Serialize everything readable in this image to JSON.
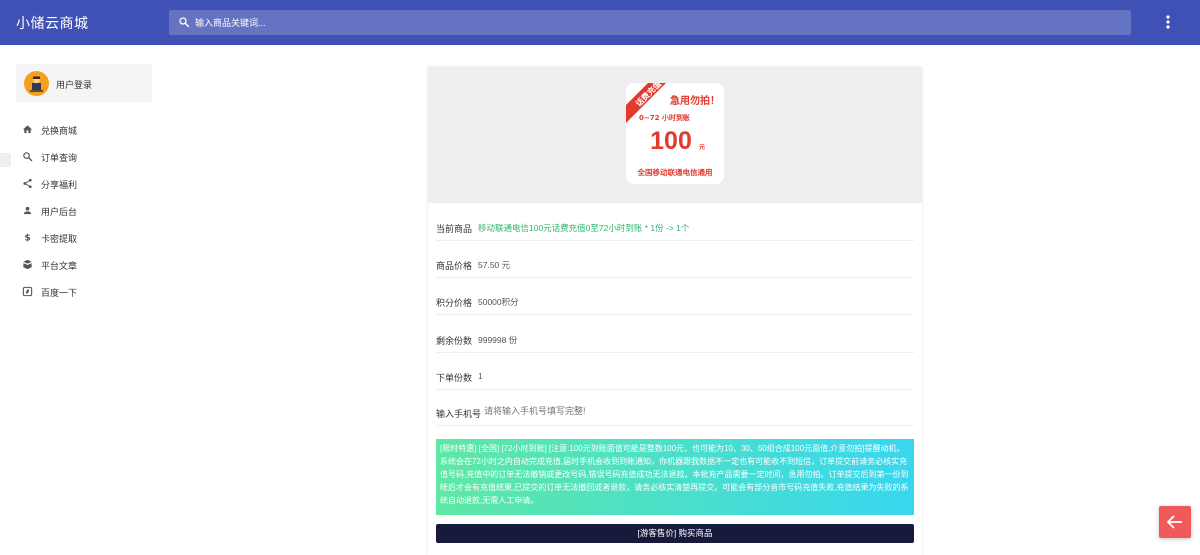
{
  "app": {
    "title": "小储云商城",
    "search_placeholder": "输入商品关键词..."
  },
  "colors": {
    "primary": "#3f51b5",
    "search_bg": "#6573c3",
    "accent_green": "#2fb36e",
    "notice_gradient_start": "#5ee8a4",
    "notice_gradient_end": "#38d6f0",
    "buy_button": "#181a3c",
    "fab": "#f15a5a"
  },
  "sidebar": {
    "user_label": "用户登录",
    "items": [
      {
        "label": "兑换商城",
        "icon": "home-icon"
      },
      {
        "label": "订单查询",
        "icon": "search-icon"
      },
      {
        "label": "分享福利",
        "icon": "share-icon"
      },
      {
        "label": "用户后台",
        "icon": "person-icon"
      },
      {
        "label": "卡密提取",
        "icon": "dollar-icon"
      },
      {
        "label": "平台文章",
        "icon": "book-icon"
      },
      {
        "label": "百度一下",
        "icon": "compass-icon"
      }
    ]
  },
  "product": {
    "image": {
      "ribbon": "话费充值",
      "headline": "急用勿拍！",
      "subline": "0~72 小时到账",
      "amount": "100",
      "unit": "元",
      "footer": "全国移动联通电信通用"
    },
    "fields": [
      {
        "label": "当前商品",
        "value": "移动联通电信100元话费充值0至72小时到账 * 1份 -> 1个"
      },
      {
        "label": "商品价格",
        "value": "57.50 元"
      },
      {
        "label": "积分价格",
        "value": "50000积分"
      },
      {
        "label": "剩余份数",
        "value": "999998 份"
      },
      {
        "label": "下单份数",
        "value": "1"
      }
    ],
    "phone": {
      "label": "输入手机号",
      "placeholder": "请将输入手机号填写完整!"
    },
    "notice": "[限时特惠] [全国] [72小时到账] [注意:100元到账面值可能是整数100元，也可能为10、30、50组合成100元面值,介意勿拍]提醒动机，系统会在72小时之内自动完成充值,届时手机会收到到账通知，你机器跟我数据不一定也有可能收不到短信，订单提交前请务必核实充值号码,充值中的订单无法撤销或更改号码,错误号码充值成功无法退款。本批充产品需要一定时间，急用勿拍。订单提交后到第一份到帐后才会有充值结果,已提交的订单无法撤回或者退款，请务必核实清楚再提交。可能会有部分音市号码充值失败,充值结果为失败的系统自动退款,无需人工申请。",
    "buy_label": "[游客售价] 购买商品"
  }
}
